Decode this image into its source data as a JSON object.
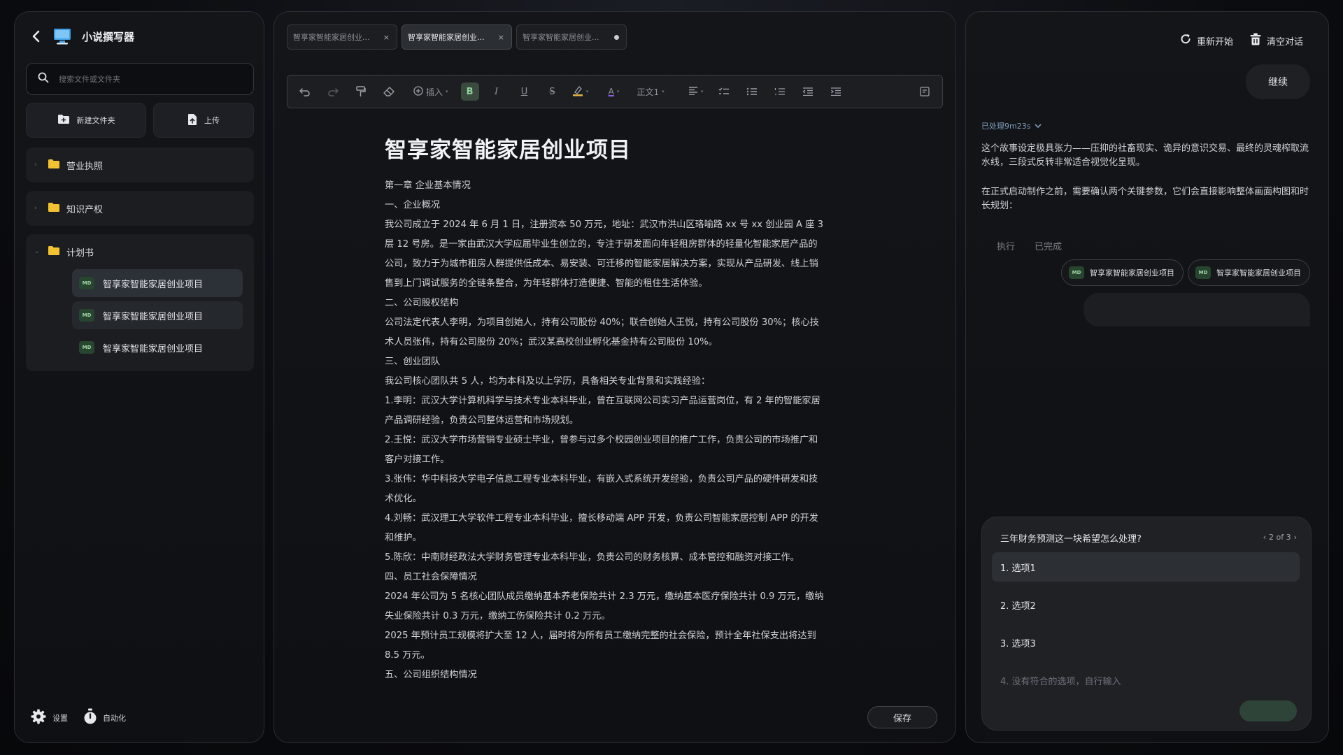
{
  "app": {
    "title": "小说撰写器"
  },
  "search": {
    "placeholder": "搜索文件或文件夹"
  },
  "actions": {
    "new_folder": "新建文件夹",
    "upload": "上传"
  },
  "tree": {
    "folders": [
      {
        "name": "营业执照",
        "expanded": false
      },
      {
        "name": "知识产权",
        "expanded": false
      },
      {
        "name": "计划书",
        "expanded": true
      }
    ],
    "files": [
      {
        "badge": "MD",
        "name": "智享家智能家居创业项目"
      },
      {
        "badge": "MD",
        "name": "智享家智能家居创业项目"
      },
      {
        "badge": "MD",
        "name": "智享家智能家居创业项目"
      }
    ]
  },
  "footer": {
    "settings": "设置",
    "automation": "自动化"
  },
  "tabs": [
    {
      "label": "智享家智能家居创业...",
      "close": "×"
    },
    {
      "label": "智享家智能家居创业...",
      "close": "×"
    },
    {
      "label": "智享家智能家居创业..."
    }
  ],
  "toolbar": {
    "insert": "插入",
    "bold": "B",
    "italic": "I",
    "underline": "U",
    "strike": "S",
    "color": "A",
    "style": "正文1"
  },
  "document": {
    "title": "智享家智能家居创业项目",
    "paragraphs": [
      "第一章  企业基本情况",
      "一、企业概况",
      "我公司成立于 2024 年 6 月 1 日，注册资本 50 万元，地址：武汉市洪山区珞喻路 xx 号 xx 创业园 A 座 3",
      "层 12 号房。是一家由武汉大学应届毕业生创立的，专注于研发面向年轻租房群体的轻量化智能家居产品的",
      "公司，致力于为城市租房人群提供低成本、易安装、可迁移的智能家居解决方案，实现从产品研发、线上销",
      "售到上门调试服务的全链条整合，为年轻群体打造便捷、智能的租住生活体验。",
      "二、公司股权结构",
      "公司法定代表人李明，为项目创始人，持有公司股份 40%；联合创始人王悦，持有公司股份 30%；核心技",
      "术人员张伟，持有公司股份 20%；武汉某高校创业孵化基金持有公司股份 10%。",
      "三、创业团队",
      "我公司核心团队共 5 人，均为本科及以上学历，具备相关专业背景和实践经验：",
      "1.李明：武汉大学计算机科学与技术专业本科毕业，曾在互联网公司实习产品运营岗位，有 2 年的智能家居",
      "产品调研经验，负责公司整体运营和市场规划。",
      "2.王悦：武汉大学市场营销专业硕士毕业，曾参与过多个校园创业项目的推广工作，负责公司的市场推广和",
      "客户对接工作。",
      "3.张伟：华中科技大学电子信息工程专业本科毕业，有嵌入式系统开发经验，负责公司产品的硬件研发和技",
      "术优化。",
      "4.刘畅：武汉理工大学软件工程专业本科毕业，擅长移动端 APP 开发，负责公司智能家居控制 APP 的开发",
      "和维护。",
      "5.陈欣：中南财经政法大学财务管理专业本科毕业，负责公司的财务核算、成本管控和融资对接工作。",
      "四、员工社会保障情况",
      "2024 年公司为 5 名核心团队成员缴纳基本养老保险共计 2.3 万元，缴纳基本医疗保险共计 0.9 万元，缴纳",
      "失业保险共计 0.3 万元，缴纳工伤保险共计 0.2 万元。",
      "2025 年预计员工规模将扩大至 12 人，届时将为所有员工缴纳完整的社会保险，预计全年社保支出将达到",
      "8.5 万元。",
      "五、公司组织结构情况"
    ],
    "save_label": "保存"
  },
  "chat": {
    "restart": "重新开始",
    "clear": "清空对话",
    "continue": "继续",
    "processed": "已处理9m23s",
    "message1": "这个故事设定极具张力——压抑的社畜现实、诡异的意识交易、最终的灵魂榨取流水线，三段式反转非常适合视觉化呈现。",
    "message2": "在正式启动制作之前，需要确认两个关键参数，它们会直接影响整体画面构图和时长规划：",
    "steps": [
      "执行",
      "已完成"
    ],
    "chips": [
      {
        "badge": "MD",
        "label": "智享家智能家居创业项目"
      },
      {
        "badge": "MD",
        "label": "智享家智能家居创业项目"
      }
    ]
  },
  "question": {
    "title": "三年财务预测这一块希望怎么处理?",
    "pager": "2 of 3",
    "options": [
      "1. 选项1",
      "2. 选项2",
      "3. 选项3"
    ],
    "custom_placeholder": "4. 没有符合的选项，自行输入"
  },
  "colors": {
    "accent_green": "#8fd49c",
    "link_blue": "#7f9bb8"
  }
}
